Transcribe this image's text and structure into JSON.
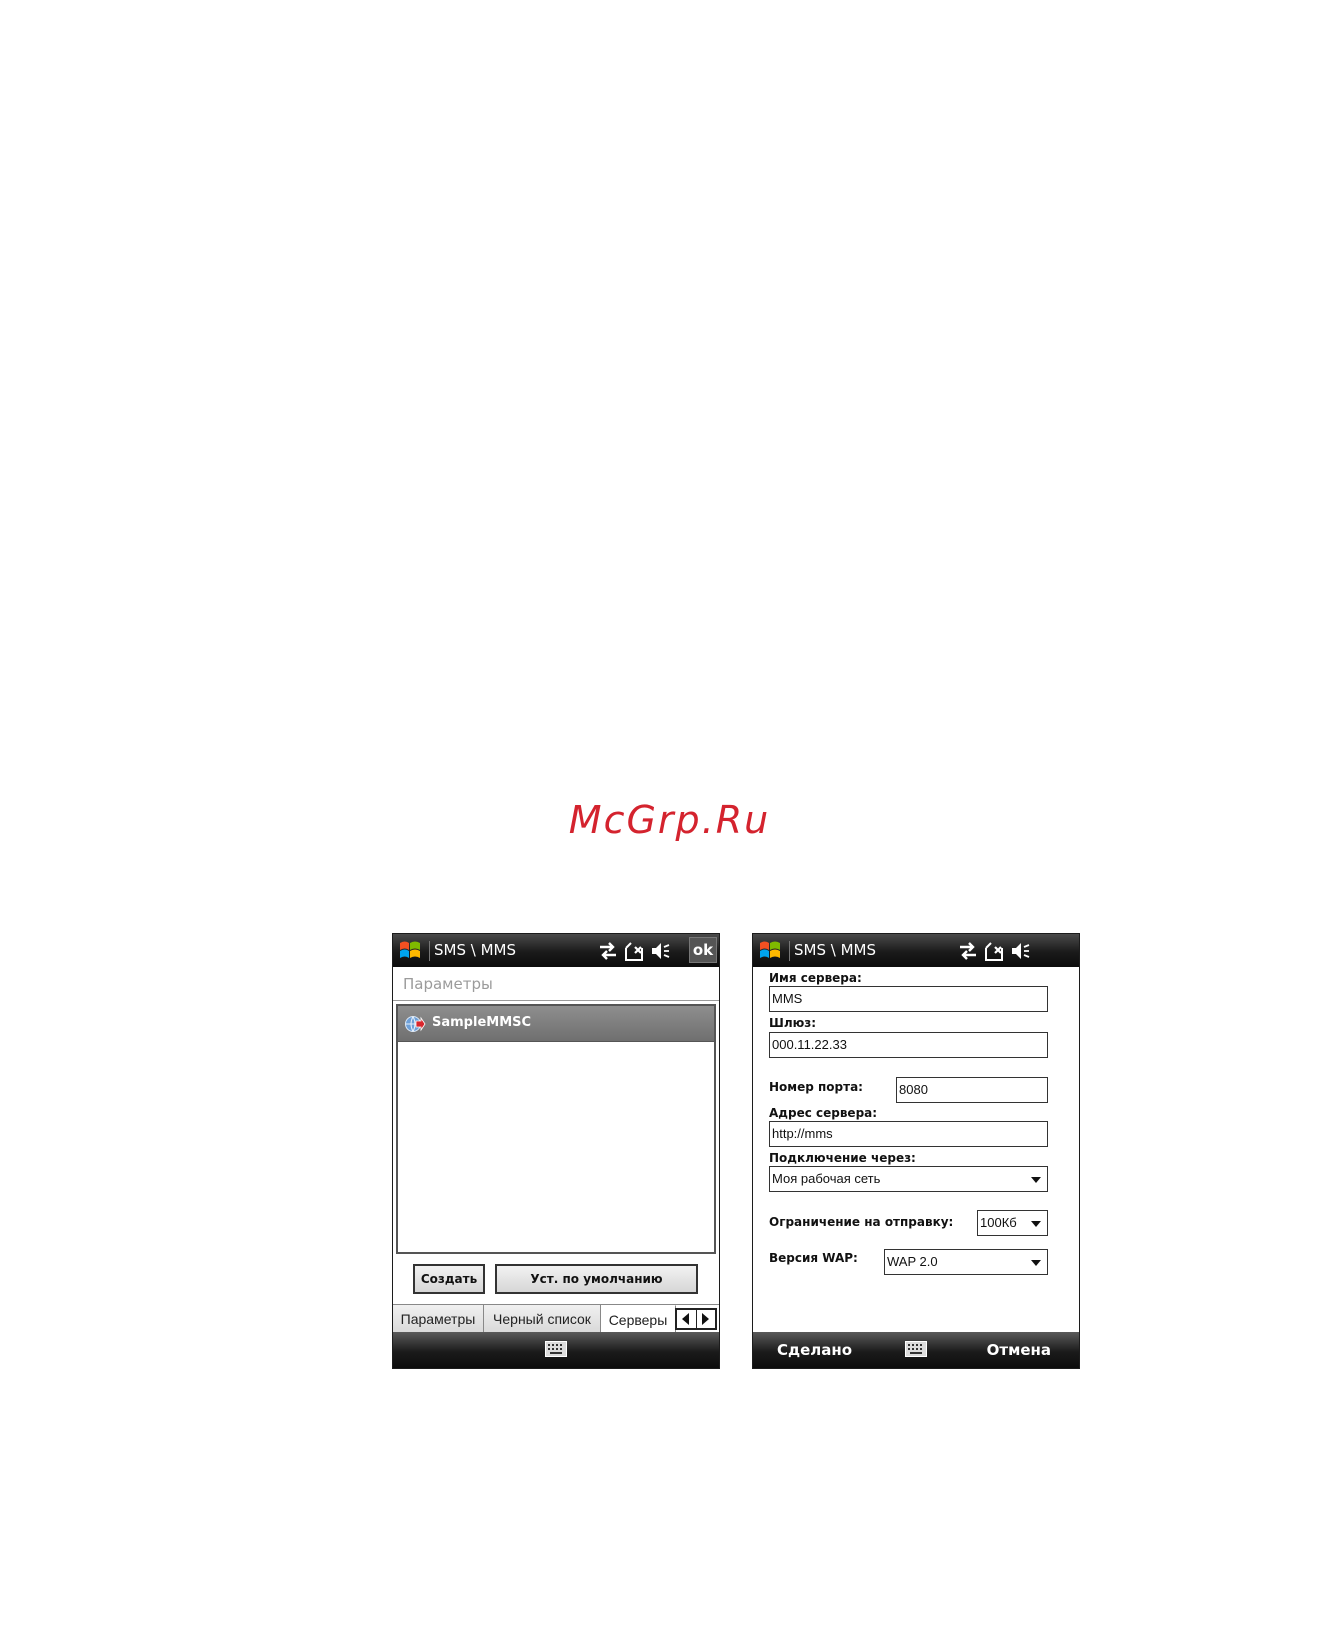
{
  "watermark": "McGrp.Ru",
  "left_screen": {
    "title": "SMS \\ MMS",
    "ok_label": "ok",
    "section_header": "Параметры",
    "server_list": [
      {
        "label": "SampleMMSC"
      }
    ],
    "buttons": {
      "create": "Создать",
      "set_default": "Уст. по умолчанию"
    },
    "tabs": [
      {
        "label": "Параметры"
      },
      {
        "label": "Черный список"
      },
      {
        "label": "Серверы",
        "selected": true
      }
    ],
    "icons": [
      "windows-start-icon",
      "connectivity-icon",
      "signal-icon",
      "speaker-mute-icon",
      "globe-server-icon",
      "keyboard-icon",
      "arrow-left-icon",
      "arrow-right-icon"
    ]
  },
  "right_screen": {
    "title": "SMS \\ MMS",
    "form": {
      "server_name_label": "Имя сервера:",
      "server_name_value": "MMS",
      "gateway_label": "Шлюз:",
      "gateway_value": "000.11.22.33",
      "port_label": "Номер порта:",
      "port_value": "8080",
      "server_address_label": "Адрес сервера:",
      "server_address_value": "http://mms",
      "connect_via_label": "Подключение через:",
      "connect_via_value": "Моя рабочая сеть",
      "send_limit_label": "Ограничение на отправку:",
      "send_limit_value": "100Кб",
      "wap_version_label": "Версия WAP:",
      "wap_version_value": "WAP 2.0"
    },
    "softkeys": {
      "done": "Сделано",
      "cancel": "Отмена"
    }
  },
  "colors": {
    "watermark": "#d4232e",
    "titlebar": "#1a1a1a",
    "selection": "#7a7a7a",
    "section_header_text": "#9b9b9b"
  }
}
